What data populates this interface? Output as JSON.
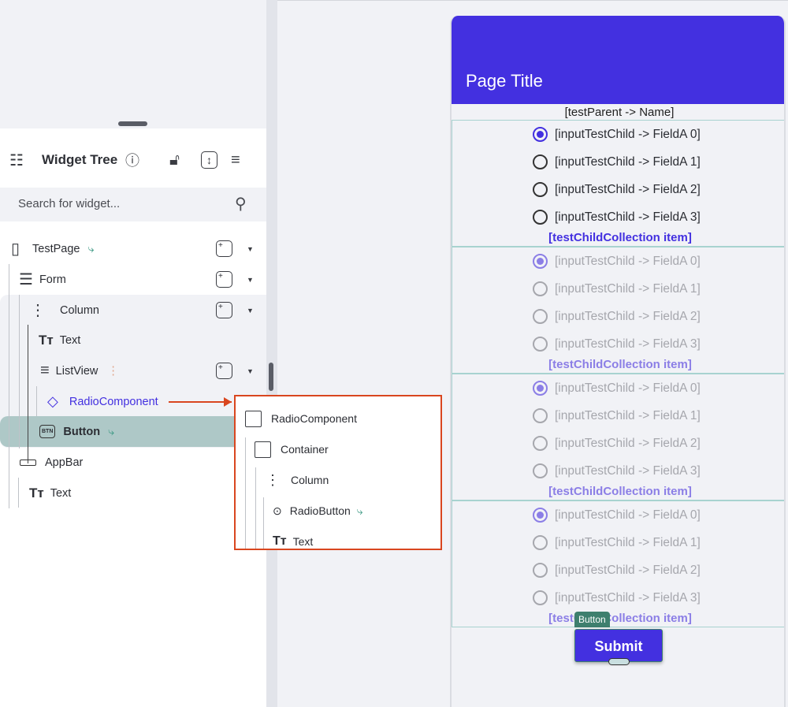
{
  "widget_tree": {
    "title": "Widget Tree",
    "search_placeholder": "Search for widget...",
    "items": [
      {
        "label": "TestPage"
      },
      {
        "label": "Form"
      },
      {
        "label": "Column"
      },
      {
        "label": "Text"
      },
      {
        "label": "ListView"
      },
      {
        "label": "RadioComponent"
      },
      {
        "label": "Button"
      },
      {
        "label": "AppBar"
      },
      {
        "label": "Text"
      }
    ]
  },
  "component_popup": {
    "items": [
      {
        "label": "RadioComponent"
      },
      {
        "label": "Container"
      },
      {
        "label": "Column"
      },
      {
        "label": "RadioButton"
      },
      {
        "label": "Text"
      }
    ]
  },
  "preview": {
    "page_title": "Page Title",
    "parent_text": "[testParent -> Name]",
    "options": [
      "[inputTestChild -> FieldA 0]",
      "[inputTestChild -> FieldA 1]",
      "[inputTestChild -> FieldA 2]",
      "[inputTestChild -> FieldA 3]"
    ],
    "item_label": "[testChildCollection item]",
    "selected_index": 0,
    "button_tag": "Button",
    "submit_label": "Submit"
  },
  "colors": {
    "primary": "#4330e0",
    "selection": "#aec8c7",
    "highlight": "#d9461f",
    "teal": "#3e9a85"
  }
}
